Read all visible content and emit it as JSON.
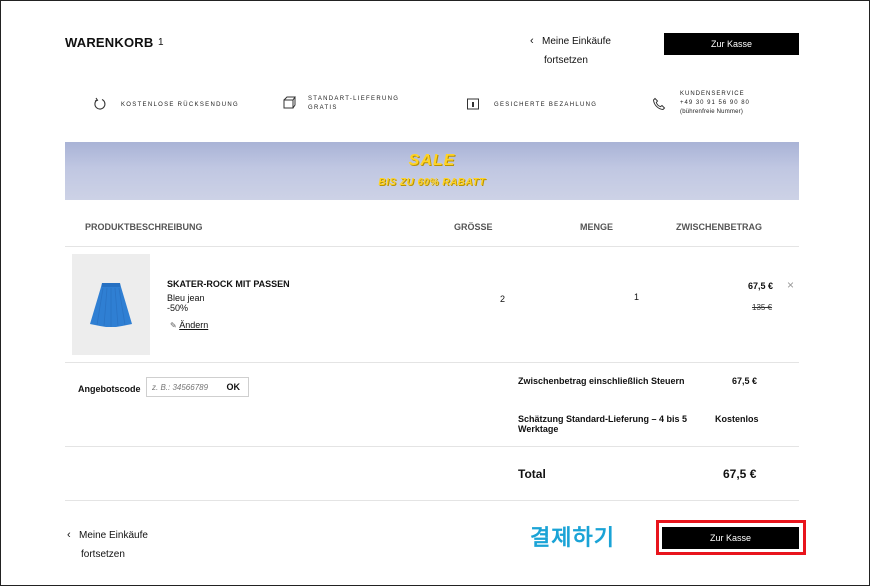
{
  "header": {
    "title": "WARENKORB",
    "count": "1",
    "continue_line1": "Meine Einkäufe",
    "continue_line2": "fortsetzen",
    "checkout_label": "Zur Kasse"
  },
  "features": [
    {
      "icon": "return-arrow-icon",
      "line1": "KOSTENLOSE RÜCKSENDUNG"
    },
    {
      "icon": "box-icon",
      "line1": "STANDART-LIEFERUNG",
      "line2": "GRATIS"
    },
    {
      "icon": "lock-card-icon",
      "line1": "GESICHERTE BEZAHLUNG"
    },
    {
      "icon": "phone-icon",
      "line1": "KUNDENSERVICE",
      "line2": "+49 30 91 56 90 80",
      "line3": "(bührenfreie Nummer)"
    }
  ],
  "banner": {
    "title": "SALE",
    "subtitle": "BIS ZU 60% RABATT"
  },
  "table": {
    "headers": [
      "PRODUKTBESCHREIBUNG",
      "GRÖSSE",
      "MENGE",
      "ZWISCHENBETRAG"
    ]
  },
  "item": {
    "name": "SKATER-ROCK MIT PASSEN",
    "color": "Bleu jean",
    "discount": "-50%",
    "edit_label": "Ändern",
    "size": "2",
    "quantity": "1",
    "price": "67,5 €",
    "old_price": "135 €",
    "remove_symbol": "×"
  },
  "promo": {
    "label": "Angebotscode",
    "placeholder": "z. B.: 34566789",
    "ok_label": "OK"
  },
  "summary": {
    "subtotal_label": "Zwischenbetrag einschließlich Steuern",
    "subtotal_value": "67,5 €",
    "shipping_label_1": "Schätzung Standard-Lieferung – 4 bis 5",
    "shipping_label_2": "Werktage",
    "shipping_value": "Kostenlos",
    "total_label": "Total",
    "total_value": "67,5 €"
  },
  "footer": {
    "continue_line1": "Meine Einkäufe",
    "continue_line2": "fortsetzen",
    "checkout_label": "Zur Kasse",
    "annotation": "결제하기"
  },
  "colors": {
    "button_bg": "#000000",
    "banner_text": "#ffd326",
    "annotation_text": "#1aa3d6",
    "highlight_border": "#e8141c"
  }
}
